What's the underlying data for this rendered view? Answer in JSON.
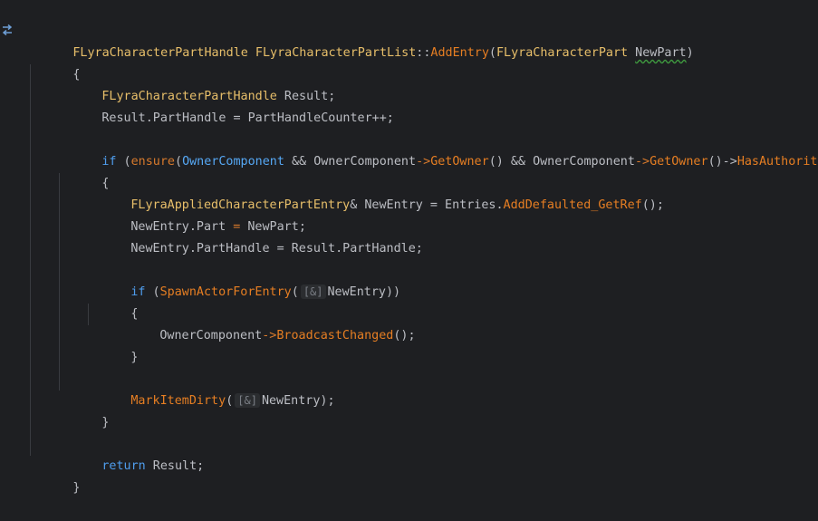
{
  "colors": {
    "background": "#1e1f22",
    "type_class": "#e8bf6a",
    "function": "#e67e22",
    "keyword": "#4f9ded",
    "plain": "#bcbec4"
  },
  "gutter": {
    "icon": "implementation-arrows-icon"
  },
  "code": {
    "l1": {
      "t1": "FLyraCharacterPartHandle",
      "t2": " ",
      "t3": "FLyraCharacterPartList",
      "t4": "::",
      "t5": "AddEntry",
      "t6": "(",
      "t7": "FLyraCharacterPart",
      "t8": " ",
      "t9": "NewPart",
      "t10": ")"
    },
    "l2": {
      "t1": "{"
    },
    "l3": {
      "t1": "FLyraCharacterPartHandle",
      "t2": " Result;"
    },
    "l4": {
      "t1": "Result.PartHandle = PartHandleCounter++;"
    },
    "l5": {},
    "l6": {
      "t1": "if",
      "t2": " (",
      "t3": "ensure",
      "t4": "(",
      "t5": "OwnerComponent",
      "t6": " && ",
      "t7": "OwnerComponent",
      "t8": "->",
      "t9": "GetOwner",
      "t10": "() && ",
      "t11": "OwnerComponent",
      "t12": "->",
      "t13": "GetOwner",
      "t14": "()->",
      "t15": "HasAuthority",
      "t16": "()))"
    },
    "l7": {
      "t1": "{"
    },
    "l8": {
      "t1": "FLyraAppliedCharacterPartEntry",
      "t2": "& NewEntry = Entries.",
      "t3": "AddDefaulted_GetRef",
      "t4": "();"
    },
    "l9": {
      "t1": "NewEntry.Part",
      "t2": " = ",
      "t3": "NewPart",
      "t4": ";"
    },
    "l10": {
      "t1": "NewEntry.PartHandle = Result.PartHandle;"
    },
    "l11": {},
    "l12": {
      "t1": "if",
      "t2": " (",
      "t3": "SpawnActorForEntry",
      "t4": "(",
      "hint": "[&]",
      "t5": "NewEntry))"
    },
    "l13": {
      "t1": "{"
    },
    "l14": {
      "t1": "OwnerComponent",
      "t2": "->",
      "t3": "BroadcastChanged",
      "t4": "();"
    },
    "l15": {
      "t1": "}"
    },
    "l16": {},
    "l17": {
      "t1": "MarkItemDirty",
      "t2": "(",
      "hint": "[&]",
      "t3": "NewEntry);"
    },
    "l18": {
      "t1": "}"
    },
    "l19": {},
    "l20": {
      "t1": "return",
      "t2": " Result;"
    },
    "l21": {
      "t1": "}"
    }
  }
}
